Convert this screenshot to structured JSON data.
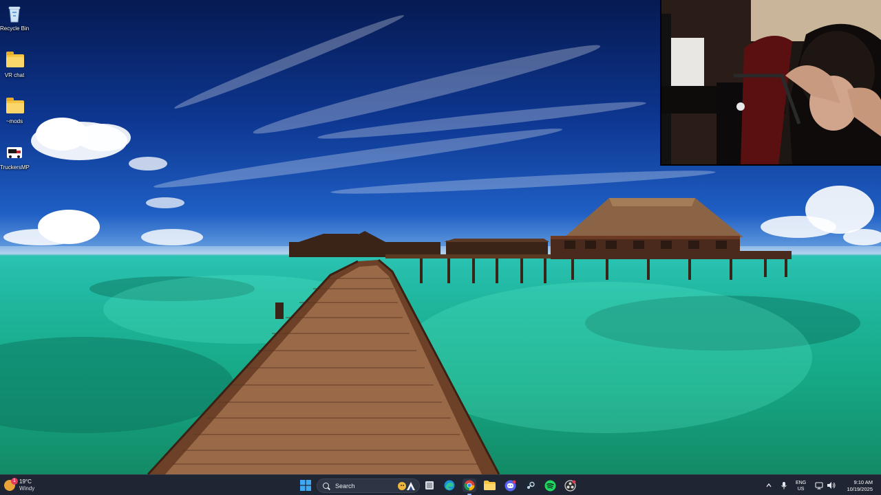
{
  "desktop": {
    "icons": [
      {
        "label": "Recycle Bin",
        "icon": "recycle-bin-icon"
      },
      {
        "label": "VR chat",
        "icon": "folder-icon"
      },
      {
        "label": "~mods",
        "icon": "folder-icon"
      },
      {
        "label": "TruckersMP",
        "icon": "truckersmp-icon"
      }
    ]
  },
  "taskbar": {
    "weather": {
      "temp": "19°C",
      "condition": "Windy",
      "badge": "1"
    },
    "search_label": "Search",
    "pinned": [
      {
        "name": "start",
        "icon": "windows-logo-icon"
      },
      {
        "name": "task-view",
        "icon": "task-view-icon"
      },
      {
        "name": "edge",
        "icon": "edge-icon"
      },
      {
        "name": "chrome",
        "icon": "chrome-icon"
      },
      {
        "name": "file-explorer",
        "icon": "folder-icon"
      },
      {
        "name": "discord",
        "icon": "discord-icon"
      },
      {
        "name": "steam",
        "icon": "steam-icon"
      },
      {
        "name": "spotify",
        "icon": "spotify-icon"
      },
      {
        "name": "obs",
        "icon": "obs-icon"
      }
    ],
    "tray": {
      "lang_top": "ENG",
      "lang_bottom": "US",
      "time": "9:10 AM",
      "date": "10/19/2025"
    }
  },
  "colors": {
    "taskbar": "#1f2533",
    "accent": "#8fb4ff",
    "sea": "#1fb69d",
    "sky": "#1f5fc4"
  }
}
